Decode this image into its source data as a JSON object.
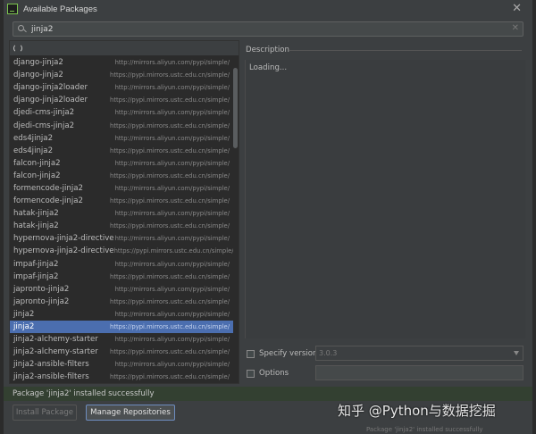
{
  "window": {
    "title": "Available Packages"
  },
  "search": {
    "value": "jinja2"
  },
  "packages": [
    {
      "name": "django-jinja2",
      "repo": "http://mirrors.aliyun.com/pypi/simple/"
    },
    {
      "name": "django-jinja2",
      "repo": "https://pypi.mirrors.ustc.edu.cn/simple/"
    },
    {
      "name": "django-jinja2loader",
      "repo": "http://mirrors.aliyun.com/pypi/simple/"
    },
    {
      "name": "django-jinja2loader",
      "repo": "https://pypi.mirrors.ustc.edu.cn/simple/"
    },
    {
      "name": "djedi-cms-jinja2",
      "repo": "http://mirrors.aliyun.com/pypi/simple/"
    },
    {
      "name": "djedi-cms-jinja2",
      "repo": "https://pypi.mirrors.ustc.edu.cn/simple/"
    },
    {
      "name": "eds4jinja2",
      "repo": "http://mirrors.aliyun.com/pypi/simple/"
    },
    {
      "name": "eds4jinja2",
      "repo": "https://pypi.mirrors.ustc.edu.cn/simple/"
    },
    {
      "name": "falcon-jinja2",
      "repo": "http://mirrors.aliyun.com/pypi/simple/"
    },
    {
      "name": "falcon-jinja2",
      "repo": "https://pypi.mirrors.ustc.edu.cn/simple/"
    },
    {
      "name": "formencode-jinja2",
      "repo": "http://mirrors.aliyun.com/pypi/simple/"
    },
    {
      "name": "formencode-jinja2",
      "repo": "https://pypi.mirrors.ustc.edu.cn/simple/"
    },
    {
      "name": "hatak-jinja2",
      "repo": "http://mirrors.aliyun.com/pypi/simple/"
    },
    {
      "name": "hatak-jinja2",
      "repo": "https://pypi.mirrors.ustc.edu.cn/simple/"
    },
    {
      "name": "hypernova-jinja2-directive",
      "repo": "http://mirrors.aliyun.com/pypi/simple/"
    },
    {
      "name": "hypernova-jinja2-directive",
      "repo": "https://pypi.mirrors.ustc.edu.cn/simple/"
    },
    {
      "name": "impaf-jinja2",
      "repo": "http://mirrors.aliyun.com/pypi/simple/"
    },
    {
      "name": "impaf-jinja2",
      "repo": "https://pypi.mirrors.ustc.edu.cn/simple/"
    },
    {
      "name": "japronto-jinja2",
      "repo": "http://mirrors.aliyun.com/pypi/simple/"
    },
    {
      "name": "japronto-jinja2",
      "repo": "https://pypi.mirrors.ustc.edu.cn/simple/"
    },
    {
      "name": "jinja2",
      "repo": "http://mirrors.aliyun.com/pypi/simple/"
    },
    {
      "name": "jinja2",
      "repo": "https://pypi.mirrors.ustc.edu.cn/simple/",
      "selected": true
    },
    {
      "name": "jinja2-alchemy-starter",
      "repo": "http://mirrors.aliyun.com/pypi/simple/"
    },
    {
      "name": "jinja2-alchemy-starter",
      "repo": "https://pypi.mirrors.ustc.edu.cn/simple/"
    },
    {
      "name": "jinja2-ansible-filters",
      "repo": "http://mirrors.aliyun.com/pypi/simple/"
    },
    {
      "name": "jinja2-ansible-filters",
      "repo": "https://pypi.mirrors.ustc.edu.cn/simple/"
    }
  ],
  "description": {
    "label": "Description",
    "body": "Loading..."
  },
  "options": {
    "specify_version_label": "Specify version",
    "version_value": "3.0.3",
    "options_label": "Options"
  },
  "status": {
    "message": "Package 'jinja2' installed successfully"
  },
  "buttons": {
    "install": "Install Package",
    "manage": "Manage Repositories"
  },
  "overlay": {
    "watermark": "知乎 @Python与数据挖掘",
    "background_status": "Package 'jinja2' installed successfully"
  },
  "colors": {
    "selection": "#4b6eaf",
    "status_bg": "#334031",
    "dialog_bg": "#3c3f41",
    "list_bg": "#2b2b2b"
  }
}
